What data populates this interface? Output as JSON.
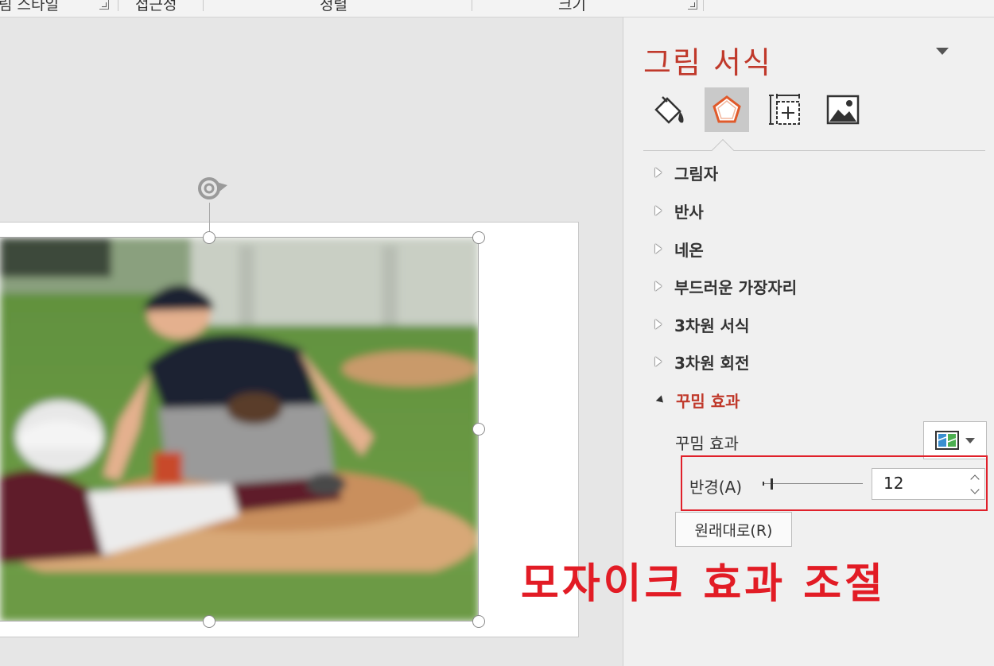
{
  "ribbon": {
    "groups": [
      "림 스타일",
      "접근성",
      "정렬",
      "크기"
    ]
  },
  "pane": {
    "title": "그림 서식",
    "category_tabs": [
      {
        "name": "fill-line",
        "icon": "paint-bucket-icon",
        "active": false
      },
      {
        "name": "effects",
        "icon": "pentagon-icon",
        "active": true
      },
      {
        "name": "size-properties",
        "icon": "size-position-icon",
        "active": false
      },
      {
        "name": "picture",
        "icon": "picture-icon",
        "active": false
      }
    ],
    "sections": [
      {
        "label": "그림자",
        "expanded": false
      },
      {
        "label": "반사",
        "expanded": false
      },
      {
        "label": "네온",
        "expanded": false
      },
      {
        "label": "부드러운 가장자리",
        "expanded": false
      },
      {
        "label": "3차원 서식",
        "expanded": false
      },
      {
        "label": "3차원 회전",
        "expanded": false
      },
      {
        "label": "꾸밈 효과",
        "expanded": true
      }
    ],
    "artistic": {
      "effect_label": "꾸밈 효과",
      "radius_label": "반경(A)",
      "radius_value": "12",
      "reset_label": "원래대로(R)"
    }
  },
  "annotation": "모자이크 효과 조절",
  "colors": {
    "accent_red": "#c0392b",
    "highlight_red": "#e0202a",
    "annotation_red": "#e21c25"
  }
}
